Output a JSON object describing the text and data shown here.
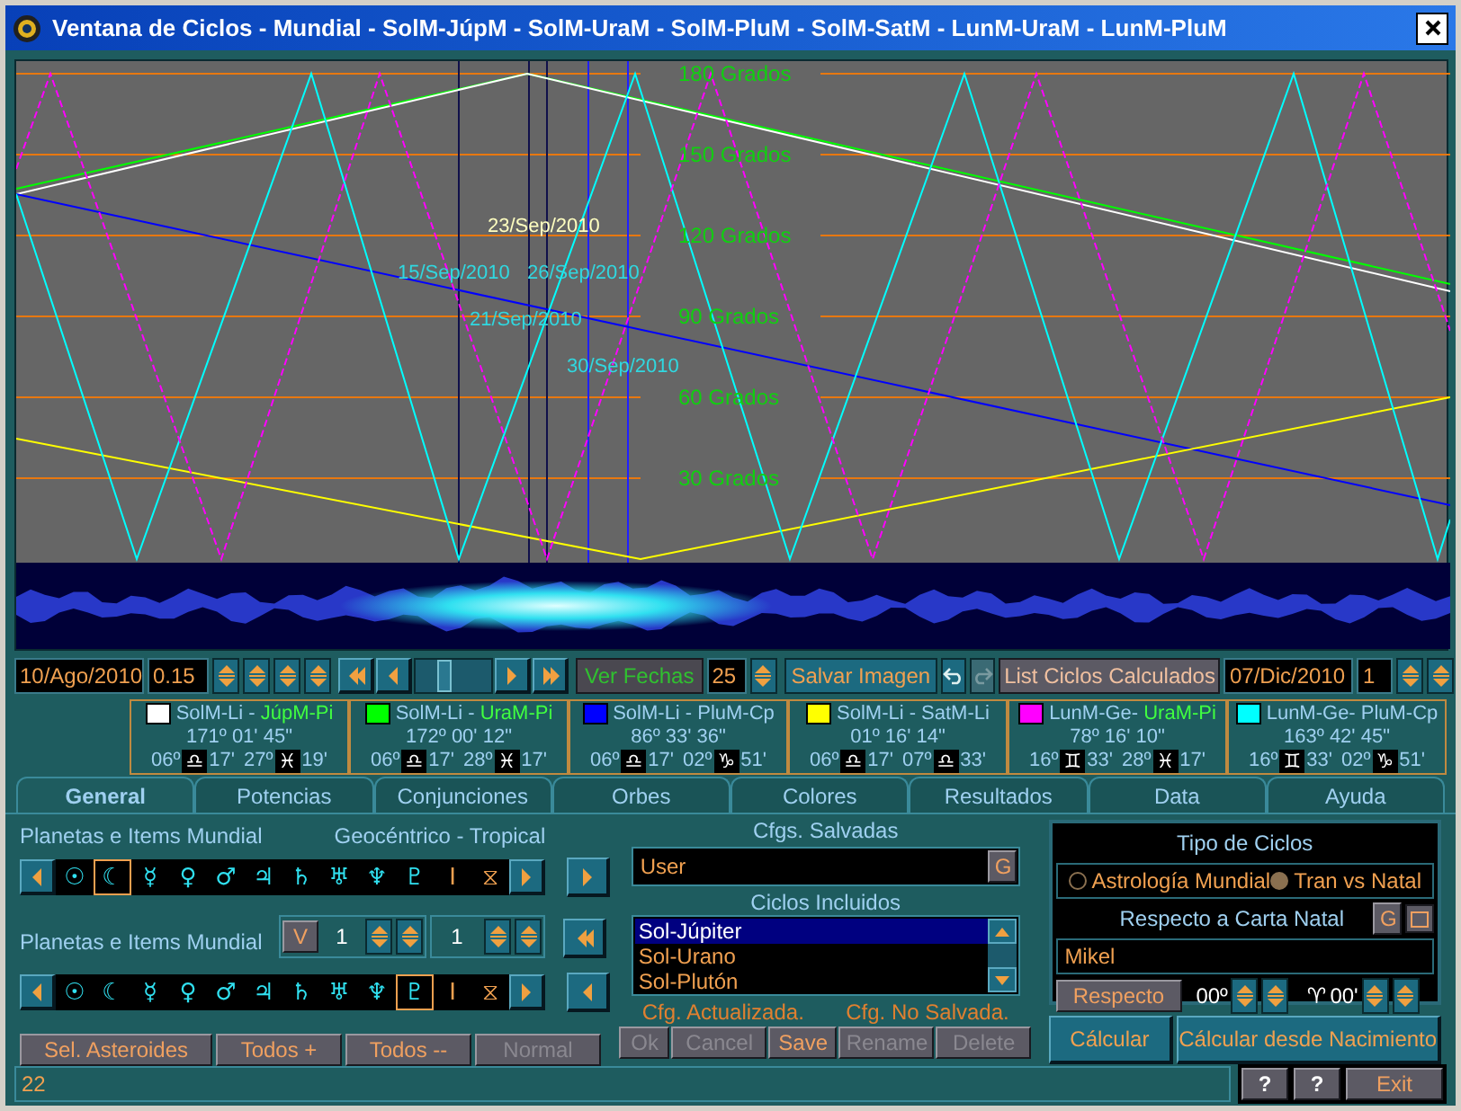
{
  "window": {
    "title": "Ventana de Ciclos - Mundial - SolM-JúpM - SolM-UraM - SolM-PluM - SolM-SatM - LunM-UraM - LunM-PluM"
  },
  "chart": {
    "grid_labels": [
      "180 Grados",
      "150 Grados",
      "120 Grados",
      "90 Grados",
      "60 Grados",
      "30 Grados"
    ],
    "date_markers": [
      {
        "label": "23/Sep/2010",
        "kind": "main"
      },
      {
        "label": "15/Sep/2010",
        "kind": "other"
      },
      {
        "label": "26/Sep/2010",
        "kind": "other"
      },
      {
        "label": "21/Sep/2010",
        "kind": "other"
      },
      {
        "label": "30/Sep/2010",
        "kind": "other"
      }
    ]
  },
  "toolbar": {
    "start_date": "10/Ago/2010",
    "step": "0.15",
    "scrubber": {
      "level": 0.35
    },
    "ver_fechas": "Ver Fechas",
    "date_count": "25",
    "save_image": "Salvar Imagen",
    "redo_disabled": true,
    "list_button": "List Ciclos Calculados",
    "end_date": "07/Dic/2010",
    "increment": "1"
  },
  "legend": [
    {
      "color": "#ffffff",
      "body": "SolM-Li -",
      "partner": "JúpM-Pi",
      "partner_highlighted": true,
      "angle": "171º 01' 45\"",
      "from_deg": "06º",
      "from_sign": "♎",
      "from_min": "17'",
      "to_deg": "27º",
      "to_sign": "♓",
      "to_min": "19'"
    },
    {
      "color": "#00ff00",
      "body": "SolM-Li -",
      "partner": "UraM-Pi",
      "partner_highlighted": true,
      "angle": "172º 00' 12\"",
      "from_deg": "06º",
      "from_sign": "♎",
      "from_min": "17'",
      "to_deg": "28º",
      "to_sign": "♓",
      "to_min": "17'"
    },
    {
      "color": "#0000ff",
      "body": "SolM-Li -",
      "partner": "PluM-Cp",
      "partner_highlighted": false,
      "angle": "86º 33' 36\"",
      "from_deg": "06º",
      "from_sign": "♎",
      "from_min": "17'",
      "to_deg": "02º",
      "to_sign": "♑",
      "to_min": "51'"
    },
    {
      "color": "#ffff00",
      "body": "SolM-Li -",
      "partner": "SatM-Li",
      "partner_highlighted": false,
      "angle": "01º 16' 14\"",
      "from_deg": "06º",
      "from_sign": "♎",
      "from_min": "17'",
      "to_deg": "07º",
      "to_sign": "♎",
      "to_min": "33'"
    },
    {
      "color": "#ff00ff",
      "body": "LunM-Ge-",
      "partner": "UraM-Pi",
      "partner_highlighted": true,
      "angle": "78º 16' 10\"",
      "from_deg": "16º",
      "from_sign": "♊",
      "from_min": "33'",
      "to_deg": "28º",
      "to_sign": "♓",
      "to_min": "17'"
    },
    {
      "color": "#00ffff",
      "body": "LunM-Ge-",
      "partner": "PluM-Cp",
      "partner_highlighted": false,
      "angle": "163º 42' 45\"",
      "from_deg": "16º",
      "from_sign": "♊",
      "from_min": "33'",
      "to_deg": "02º",
      "to_sign": "♑",
      "to_min": "51'"
    }
  ],
  "tabs": [
    {
      "label": "General",
      "selected": true
    },
    {
      "label": "Potencias",
      "selected": false
    },
    {
      "label": "Conjunciones",
      "selected": false
    },
    {
      "label": "Orbes",
      "selected": false
    },
    {
      "label": "Colores",
      "selected": false
    },
    {
      "label": "Resultados",
      "selected": false
    },
    {
      "label": "Data",
      "selected": false
    },
    {
      "label": "Ayuda",
      "selected": false
    }
  ],
  "general": {
    "planets_label_1": "Planetas e Items Mundial",
    "coordinates": "Geocéntrico - Tropical",
    "planets_1": [
      {
        "glyph": "☉",
        "kind": "planet",
        "selected": false
      },
      {
        "glyph": "☾",
        "kind": "planet",
        "selected": true
      },
      {
        "glyph": "☿",
        "kind": "planet",
        "selected": false
      },
      {
        "glyph": "♀",
        "kind": "planet",
        "selected": false
      },
      {
        "glyph": "♂",
        "kind": "planet",
        "selected": false
      },
      {
        "glyph": "♃",
        "kind": "planet",
        "selected": false
      },
      {
        "glyph": "♄",
        "kind": "planet",
        "selected": false
      },
      {
        "glyph": "♅",
        "kind": "planet",
        "selected": false
      },
      {
        "glyph": "♆",
        "kind": "planet",
        "selected": false
      },
      {
        "glyph": "♇",
        "kind": "planet",
        "selected": false
      },
      {
        "glyph": "I",
        "kind": "item",
        "selected": false
      },
      {
        "glyph": "⧖",
        "kind": "item",
        "selected": false
      }
    ],
    "orb_controls": {
      "v_button": "V",
      "value_1": "1",
      "value_2": "1"
    },
    "planets_label_2": "Planetas e Items Mundial",
    "planets_2": [
      {
        "glyph": "☉",
        "kind": "planet",
        "selected": false
      },
      {
        "glyph": "☾",
        "kind": "planet",
        "selected": false
      },
      {
        "glyph": "☿",
        "kind": "planet",
        "selected": false
      },
      {
        "glyph": "♀",
        "kind": "planet",
        "selected": false
      },
      {
        "glyph": "♂",
        "kind": "planet",
        "selected": false
      },
      {
        "glyph": "♃",
        "kind": "planet",
        "selected": false
      },
      {
        "glyph": "♄",
        "kind": "planet",
        "selected": false
      },
      {
        "glyph": "♅",
        "kind": "planet",
        "selected": false
      },
      {
        "glyph": "♆",
        "kind": "planet",
        "selected": false
      },
      {
        "glyph": "♇",
        "kind": "planet",
        "selected": true
      },
      {
        "glyph": "I",
        "kind": "item",
        "selected": false
      },
      {
        "glyph": "⧖",
        "kind": "item",
        "selected": false
      }
    ],
    "buttons": [
      {
        "label": "Sel. Asteroides",
        "disabled": false
      },
      {
        "label": "Todos +",
        "disabled": false
      },
      {
        "label": "Todos --",
        "disabled": false
      },
      {
        "label": "Normal",
        "disabled": true
      }
    ]
  },
  "configs": {
    "saved_label": "Cfgs. Salvadas",
    "saved_value": "User",
    "g_button": "G",
    "cycles_label": "Ciclos Incluidos",
    "cycles": [
      {
        "label": "Sol-Júpiter",
        "selected": true
      },
      {
        "label": "Sol-Urano",
        "selected": false
      },
      {
        "label": "Sol-Plutón",
        "selected": false
      }
    ],
    "status_updated": "Cfg. Actualizada.",
    "status_unsaved": "Cfg. No Salvada.",
    "buttons": [
      {
        "label": "Ok",
        "disabled": true
      },
      {
        "label": "Cancel",
        "disabled": true
      },
      {
        "label": "Save",
        "disabled": false
      },
      {
        "label": "Rename",
        "disabled": true
      },
      {
        "label": "Delete",
        "disabled": true
      }
    ]
  },
  "cycle_type": {
    "title": "Tipo de Ciclos",
    "options": [
      {
        "label": "Astrología Mundial",
        "selected": false
      },
      {
        "label": "Tran vs Natal",
        "selected": true
      }
    ],
    "natal_label": "Respecto a Carta Natal",
    "g_button": "G",
    "natal_name": "Mikel",
    "respecto_button": "Respecto",
    "degrees": "00º",
    "sign": "♈",
    "minutes": "00'"
  },
  "actions": [
    "Cálcular",
    "Cálcular desde Nacimiento"
  ],
  "status_bar": {
    "text": "22",
    "buttons": [
      "?",
      "?",
      "Exit"
    ]
  }
}
